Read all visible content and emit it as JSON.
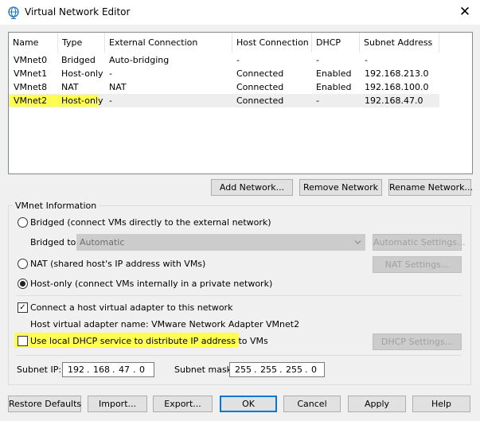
{
  "window": {
    "title": "Virtual Network Editor",
    "close_glyph": "✕"
  },
  "table": {
    "headers": [
      "Name",
      "Type",
      "External Connection",
      "Host Connection",
      "DHCP",
      "Subnet Address"
    ],
    "rows": [
      [
        "VMnet0",
        "Bridged",
        "Auto-bridging",
        "-",
        "-",
        "-"
      ],
      [
        "VMnet1",
        "Host-only",
        "-",
        "Connected",
        "Enabled",
        "192.168.213.0"
      ],
      [
        "VMnet8",
        "NAT",
        "NAT",
        "Connected",
        "Enabled",
        "192.168.100.0"
      ],
      [
        "VMnet2",
        "Host-only",
        "-",
        "Connected",
        "-",
        "192.168.47.0"
      ]
    ],
    "selected_row": 3
  },
  "list_buttons": {
    "add": "Add Network...",
    "remove": "Remove Network",
    "rename": "Rename Network..."
  },
  "info": {
    "group_label": "VMnet Information",
    "bridged_label": "Bridged (connect VMs directly to the external network)",
    "bridged_to_label": "Bridged to:",
    "bridged_to_value": "Automatic",
    "automatic_settings": "Automatic Settings...",
    "nat_label": "NAT (shared host's IP address with VMs)",
    "nat_settings": "NAT Settings...",
    "hostonly_label": "Host-only (connect VMs internally in a private network)",
    "selected_mode": "host-only",
    "connect_adapter_label": "Connect a host virtual adapter to this network",
    "connect_adapter_checked": true,
    "adapter_name_label": "Host virtual adapter name: VMware Network Adapter VMnet2",
    "dhcp_label": "Use local DHCP service to distribute IP address to VMs",
    "dhcp_checked": false,
    "dhcp_settings": "DHCP Settings...",
    "subnet_ip_label": "Subnet IP:",
    "subnet_ip": [
      "192",
      "168",
      "47",
      "0"
    ],
    "subnet_mask_label": "Subnet mask:",
    "subnet_mask": [
      "255",
      "255",
      "255",
      "0"
    ]
  },
  "footer": {
    "restore": "Restore Defaults",
    "import": "Import...",
    "export": "Export...",
    "ok": "OK",
    "cancel": "Cancel",
    "apply": "Apply",
    "help": "Help"
  },
  "colors": {
    "highlight": "#ffff3c",
    "icon_blue": "#1e73be"
  }
}
